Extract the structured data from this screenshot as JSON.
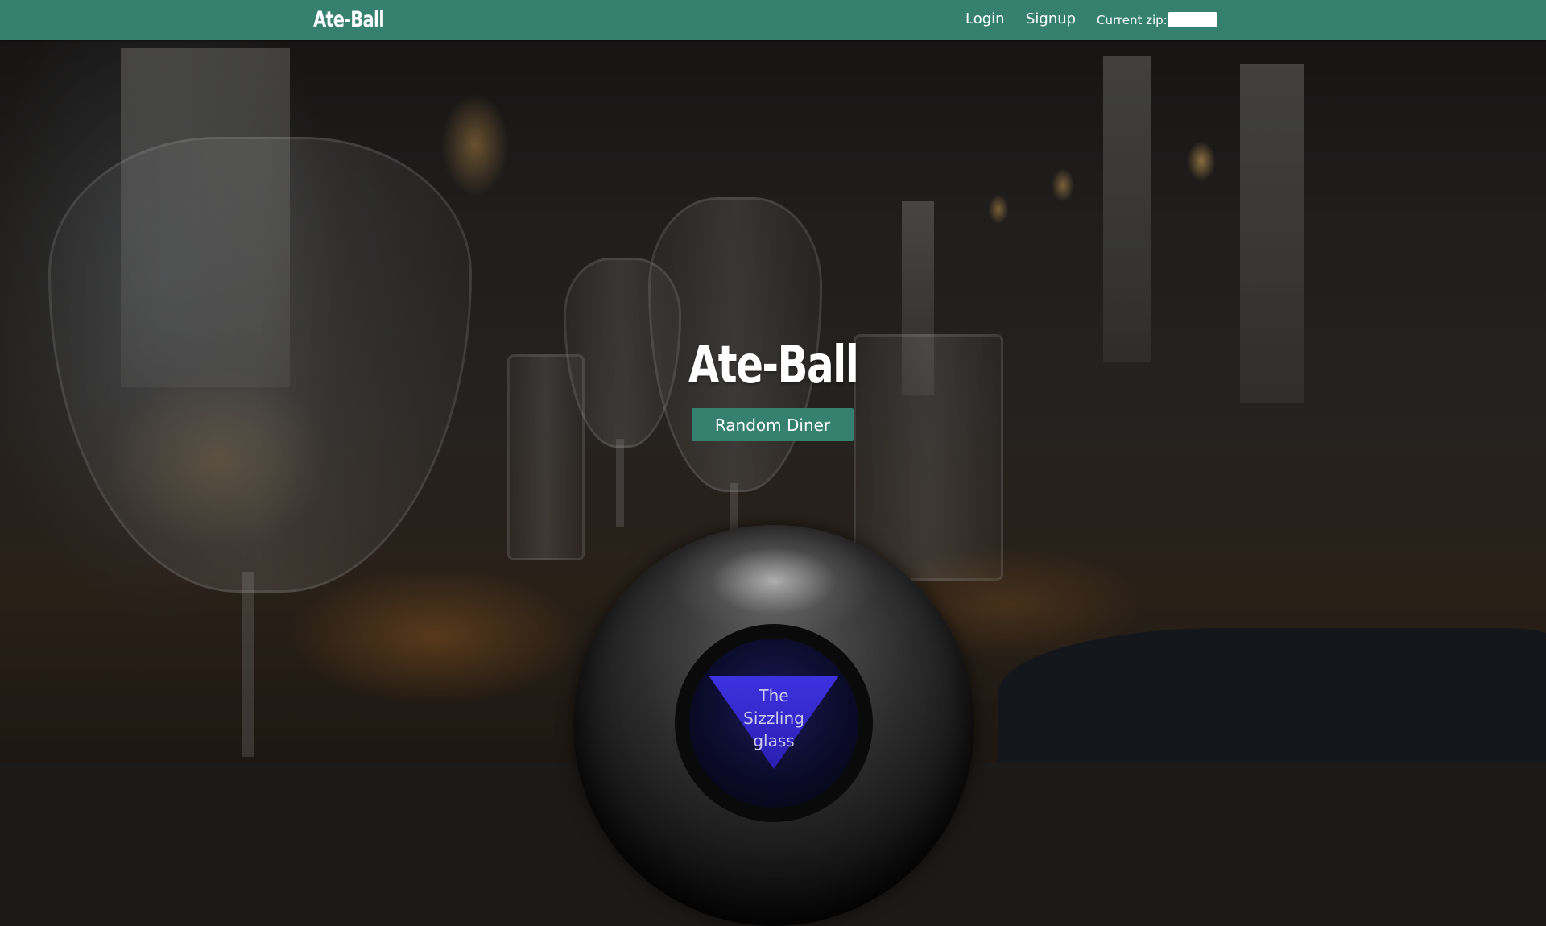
{
  "navbar": {
    "brand": "Ate-Ball",
    "login": "Login",
    "signup": "Signup",
    "zip_label": "Current zip:",
    "zip_value": ""
  },
  "hero": {
    "title": "Ate-Ball",
    "button_label": "Random Diner"
  },
  "eight_ball": {
    "answer_line1": "The",
    "answer_line2": "Sizzling",
    "answer_line3": "glass"
  },
  "colors": {
    "primary": "#35806f",
    "triangle": "#3a2fd8"
  }
}
